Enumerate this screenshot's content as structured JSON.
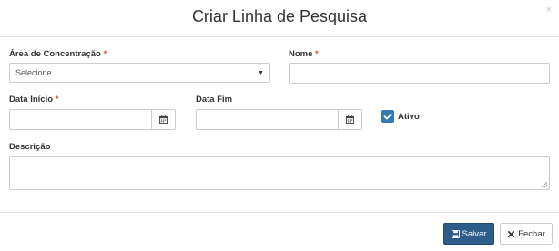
{
  "modal": {
    "title": "Criar Linha de Pesquisa",
    "close_glyph": "×"
  },
  "form": {
    "area": {
      "label": "Área de Concentração",
      "required_mark": "*",
      "selected": "Selecione"
    },
    "nome": {
      "label": "Nome",
      "required_mark": "*",
      "value": ""
    },
    "data_inicio": {
      "label": "Data Início",
      "required_mark": "*",
      "value": ""
    },
    "data_fim": {
      "label": "Data Fim",
      "value": ""
    },
    "ativo": {
      "label": "Ativo",
      "checked": true
    },
    "descricao": {
      "label": "Descrição",
      "value": ""
    }
  },
  "footer": {
    "save_label": "Salvar",
    "close_label": "Fechar"
  },
  "colors": {
    "required": "#e74c3c",
    "primary": "#2c5d8a",
    "checkbox": "#337ab7"
  },
  "icons": [
    "close-icon",
    "chevron-down-icon",
    "calendar-icon",
    "check-icon",
    "floppy-disk-icon",
    "times-icon",
    "resize-handle-icon"
  ]
}
